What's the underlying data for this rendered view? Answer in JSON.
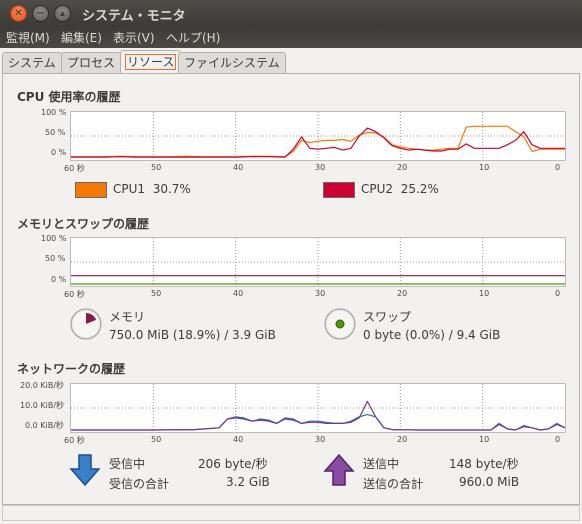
{
  "window": {
    "title": "システム・モニタ"
  },
  "menus": [
    "監視(M)",
    "編集(E)",
    "表示(V)",
    "ヘルプ(H)"
  ],
  "tabs": [
    "システム",
    "プロセス",
    "リソース",
    "ファイルシステム"
  ],
  "x_ticks": [
    "60 秒",
    "50",
    "40",
    "30",
    "20",
    "10",
    "0"
  ],
  "percent_ticks": [
    "100 %",
    "50 %",
    "0 %"
  ],
  "cpu": {
    "heading": "CPU 使用率の履歴",
    "legend": [
      {
        "label": "CPU1",
        "value": "30.7%",
        "color": "#f57900"
      },
      {
        "label": "CPU2",
        "value": "25.2%",
        "color": "#cc0033"
      }
    ]
  },
  "memory": {
    "heading": "メモリとスワップの履歴",
    "memory_label": "メモリ",
    "memory_value": "750.0 MiB (18.9%) / 3.9 GiB",
    "memory_color": "#8b1a4a",
    "swap_label": "スワップ",
    "swap_value": "0 byte (0.0%) / 9.4 GiB",
    "swap_color": "#4e9a06"
  },
  "network": {
    "heading": "ネットワークの履歴",
    "y_ticks": [
      "20.0 KiB/秒",
      "10.0 KiB/秒",
      "0.0 KiB/秒"
    ],
    "recv_label": "受信中",
    "recv_rate": "206 byte/秒",
    "recv_total_label": "受信の合計",
    "recv_total": "3.2 GiB",
    "recv_color": "#2c6fb2",
    "send_label": "送信中",
    "send_rate": "148 byte/秒",
    "send_total_label": "送信の合計",
    "send_total": "960.0 MiB",
    "send_color": "#75358c"
  },
  "chart_data": [
    {
      "type": "line",
      "title": "CPU 使用率の履歴",
      "x": [
        60,
        58,
        56,
        54,
        52,
        50,
        48,
        46,
        44,
        42,
        40,
        38,
        36,
        34,
        33,
        32,
        31,
        30,
        29,
        28,
        27,
        26,
        25,
        24,
        23,
        22,
        21,
        20,
        19,
        18,
        17,
        16,
        15,
        14,
        13,
        12,
        11,
        10,
        9,
        8,
        7,
        6,
        5,
        4,
        3,
        2,
        1,
        0
      ],
      "xlim": [
        60,
        0
      ],
      "ylim": [
        0,
        100
      ],
      "series": [
        {
          "name": "CPU1",
          "values": [
            3,
            3,
            3,
            4,
            3,
            3,
            3,
            4,
            3,
            3,
            3,
            4,
            4,
            3,
            15,
            40,
            35,
            38,
            40,
            40,
            42,
            38,
            52,
            58,
            57,
            48,
            30,
            25,
            22,
            20,
            18,
            18,
            20,
            22,
            22,
            70,
            72,
            72,
            72,
            72,
            72,
            60,
            48,
            15,
            20,
            20,
            20,
            20
          ]
        },
        {
          "name": "CPU2",
          "values": [
            2,
            2,
            2,
            3,
            2,
            2,
            2,
            2,
            2,
            2,
            2,
            3,
            3,
            2,
            20,
            48,
            22,
            20,
            22,
            24,
            18,
            22,
            50,
            68,
            60,
            46,
            28,
            22,
            18,
            20,
            18,
            16,
            16,
            20,
            20,
            32,
            22,
            22,
            22,
            22,
            30,
            40,
            60,
            30,
            22,
            22,
            22,
            22
          ]
        }
      ]
    },
    {
      "type": "line",
      "title": "メモリとスワップの履歴",
      "x": [
        60,
        0
      ],
      "xlim": [
        60,
        0
      ],
      "ylim": [
        0,
        100
      ],
      "series": [
        {
          "name": "メモリ",
          "values": [
            18.9,
            18.9
          ]
        },
        {
          "name": "スワップ",
          "values": [
            0,
            0
          ]
        }
      ]
    },
    {
      "type": "line",
      "title": "ネットワークの履歴",
      "x": [
        60,
        55,
        50,
        45,
        42,
        41,
        40,
        39,
        38,
        37,
        36,
        35,
        34,
        33,
        32,
        31,
        30,
        29,
        28,
        27,
        26,
        25,
        24,
        23,
        22,
        21,
        20,
        19,
        18,
        17,
        16,
        15,
        14,
        13,
        12,
        11,
        10,
        9,
        8,
        7,
        6,
        5,
        4,
        3,
        2,
        1,
        0
      ],
      "xlim": [
        60,
        0
      ],
      "ylim": [
        0,
        20
      ],
      "series": [
        {
          "name": "受信中",
          "values": [
            0,
            0,
            0,
            0.2,
            1,
            5,
            6,
            5.5,
            4,
            5,
            4.5,
            3,
            5.5,
            5,
            3,
            4,
            4,
            3.5,
            3,
            3,
            4,
            6,
            7,
            6,
            1,
            0.2,
            0.1,
            0.1,
            0,
            0,
            0,
            0,
            0,
            0,
            0,
            0,
            0,
            0,
            3,
            0.5,
            0,
            2,
            1,
            0,
            0.5,
            3,
            1
          ]
        },
        {
          "name": "送信中",
          "values": [
            0,
            0,
            0,
            0.2,
            1,
            5,
            5.5,
            5,
            4,
            4.5,
            4,
            3,
            5,
            4.5,
            3,
            3.5,
            3.5,
            3,
            3,
            3,
            3.5,
            5.5,
            13,
            6,
            1,
            0.2,
            0.1,
            0.1,
            0,
            0,
            0,
            0,
            0,
            0,
            0,
            0,
            0,
            0,
            2.5,
            0.5,
            0,
            1.5,
            1,
            0,
            0.5,
            2.5,
            1
          ]
        }
      ]
    }
  ]
}
